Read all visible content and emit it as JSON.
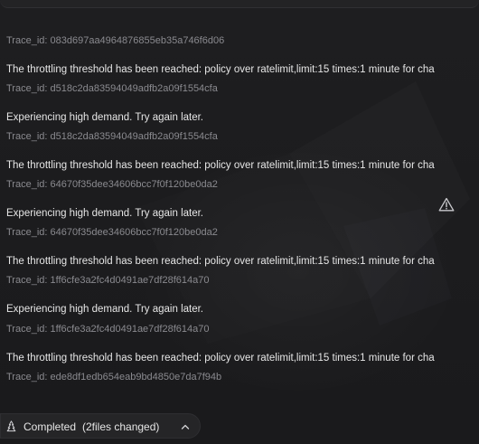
{
  "log": {
    "first_trace": "Trace_id: 083d697aa4964876855eb35a746f6d06",
    "entries": [
      {
        "message": "The throttling threshold has been reached: policy over ratelimit,limit:15 times:1 minute for cha",
        "trace": "Trace_id: d518c2da83594049adfb2a09f1554cfa"
      },
      {
        "message": "Experiencing high demand. Try again later.",
        "trace": "Trace_id: d518c2da83594049adfb2a09f1554cfa"
      },
      {
        "message": "The throttling threshold has been reached: policy over ratelimit,limit:15 times:1 minute for cha",
        "trace": "Trace_id: 64670f35dee34606bcc7f0f120be0da2"
      },
      {
        "message": "Experiencing high demand. Try again later.",
        "trace": "Trace_id: 64670f35dee34606bcc7f0f120be0da2"
      },
      {
        "message": "The throttling threshold has been reached: policy over ratelimit,limit:15 times:1 minute for cha",
        "trace": "Trace_id: 1ff6cfe3a2fc4d0491ae7df28f614a70"
      },
      {
        "message": "Experiencing high demand. Try again later.",
        "trace": "Trace_id: 1ff6cfe3a2fc4d0491ae7df28f614a70"
      },
      {
        "message": "The throttling threshold has been reached: policy over ratelimit,limit:15 times:1 minute for cha",
        "trace": "Trace_id: ede8df1edb654eab9bd4850e7da7f94b"
      }
    ]
  },
  "status": {
    "label": "Completed",
    "files_changed": "(2files changed)",
    "icon": "sparkle-tree-icon"
  },
  "icons": {
    "warning": "warning-triangle-icon",
    "collapse": "chevron-up-icon"
  },
  "colors": {
    "background": "#1b1b1d",
    "text": "#e6e6e6",
    "trace": "#8a8a8f"
  }
}
